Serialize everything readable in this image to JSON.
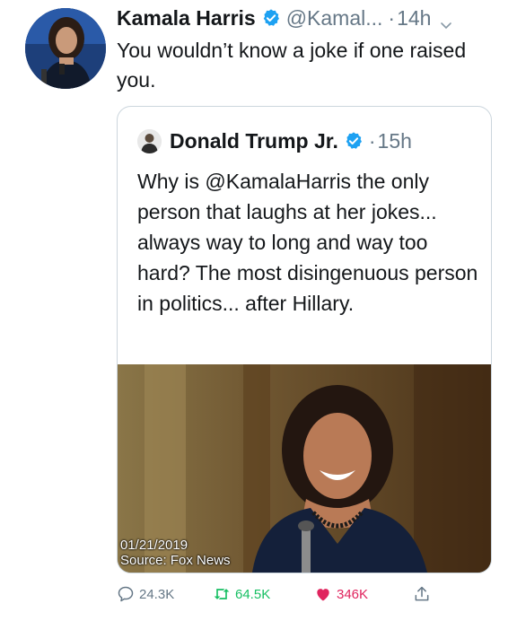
{
  "tweet": {
    "author_name": "Kamala Harris",
    "handle": "@Kamal...",
    "separator": "·",
    "time": "14h",
    "text": "You wouldn’t know a joke if one raised you.",
    "avatar_icon": "profile-photo",
    "verified_icon": "verified-badge-icon",
    "more_icon": "chevron-down-icon"
  },
  "quoted": {
    "author_name": "Donald Trump Jr.",
    "separator": "·",
    "time": "15h",
    "text": "Why is @KamalaHarris the only person that laughs at her jokes... always way to long and way too hard? The most disingenuous person in politics... after Hillary.",
    "media": {
      "caption_date": "01/21/2019",
      "caption_source": "Source: Fox News"
    }
  },
  "actions": {
    "reply_count": "24.3K",
    "retweet_count": "64.5K",
    "like_count": "346K"
  },
  "colors": {
    "verified": "#1da1f2",
    "secondary_text": "#657786",
    "retweet": "#17bf63",
    "like": "#e0245e",
    "border": "#ccd6dd"
  }
}
